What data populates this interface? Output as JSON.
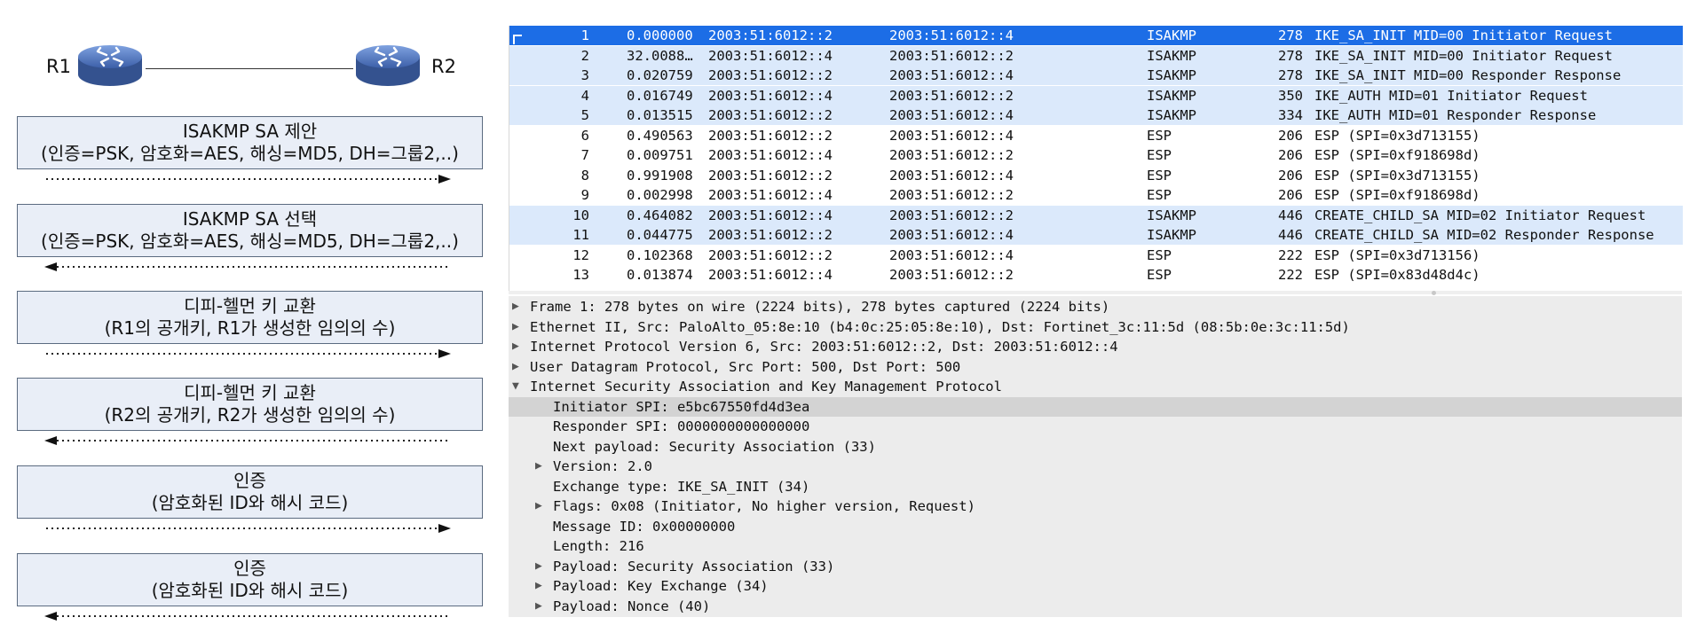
{
  "diagram": {
    "r1_label": "R1",
    "r2_label": "R2",
    "steps": [
      {
        "line1": "ISAKMP SA 제안",
        "line2": "(인증=PSK, 암호화=AES, 해싱=MD5, DH=그룹2,..)",
        "direction": "right"
      },
      {
        "line1": "ISAKMP SA 선택",
        "line2": "(인증=PSK, 암호화=AES, 해싱=MD5, DH=그룹2,..)",
        "direction": "left"
      },
      {
        "line1": "디피-헬먼 키 교환",
        "line2": "(R1의 공개키, R1가 생성한 임의의 수)",
        "direction": "right"
      },
      {
        "line1": "디피-헬먼 키 교환",
        "line2": "(R2의 공개키, R2가 생성한 임의의 수)",
        "direction": "left"
      },
      {
        "line1": "인증",
        "line2": "(암호화된 ID와 해시 코드)",
        "direction": "right"
      },
      {
        "line1": "인증",
        "line2": "(암호화된 ID와 해시 코드)",
        "direction": "left"
      }
    ]
  },
  "packets": [
    {
      "no": "1",
      "time": "0.000000",
      "src": "2003:51:6012::2",
      "dst": "2003:51:6012::4",
      "proto": "ISAKMP",
      "len": "278",
      "info": "IKE_SA_INIT MID=00 Initiator Request",
      "style": "selected"
    },
    {
      "no": "2",
      "time": "32.0088…",
      "src": "2003:51:6012::4",
      "dst": "2003:51:6012::2",
      "proto": "ISAKMP",
      "len": "278",
      "info": "IKE_SA_INIT MID=00 Initiator Request",
      "style": "isakmp"
    },
    {
      "no": "3",
      "time": "0.020759",
      "src": "2003:51:6012::2",
      "dst": "2003:51:6012::4",
      "proto": "ISAKMP",
      "len": "278",
      "info": "IKE_SA_INIT MID=00 Responder Response",
      "style": "isakmp"
    },
    {
      "no": "4",
      "time": "0.016749",
      "src": "2003:51:6012::4",
      "dst": "2003:51:6012::2",
      "proto": "ISAKMP",
      "len": "350",
      "info": "IKE_AUTH MID=01 Initiator Request",
      "style": "isakmp"
    },
    {
      "no": "5",
      "time": "0.013515",
      "src": "2003:51:6012::2",
      "dst": "2003:51:6012::4",
      "proto": "ISAKMP",
      "len": "334",
      "info": "IKE_AUTH MID=01 Responder Response",
      "style": "isakmp"
    },
    {
      "no": "6",
      "time": "0.490563",
      "src": "2003:51:6012::2",
      "dst": "2003:51:6012::4",
      "proto": "ESP",
      "len": "206",
      "info": "ESP (SPI=0x3d713155)",
      "style": "plain"
    },
    {
      "no": "7",
      "time": "0.009751",
      "src": "2003:51:6012::4",
      "dst": "2003:51:6012::2",
      "proto": "ESP",
      "len": "206",
      "info": "ESP (SPI=0xf918698d)",
      "style": "plain"
    },
    {
      "no": "8",
      "time": "0.991908",
      "src": "2003:51:6012::2",
      "dst": "2003:51:6012::4",
      "proto": "ESP",
      "len": "206",
      "info": "ESP (SPI=0x3d713155)",
      "style": "plain"
    },
    {
      "no": "9",
      "time": "0.002998",
      "src": "2003:51:6012::4",
      "dst": "2003:51:6012::2",
      "proto": "ESP",
      "len": "206",
      "info": "ESP (SPI=0xf918698d)",
      "style": "plain"
    },
    {
      "no": "10",
      "time": "0.464082",
      "src": "2003:51:6012::4",
      "dst": "2003:51:6012::2",
      "proto": "ISAKMP",
      "len": "446",
      "info": "CREATE_CHILD_SA MID=02 Initiator Request",
      "style": "isakmp"
    },
    {
      "no": "11",
      "time": "0.044775",
      "src": "2003:51:6012::2",
      "dst": "2003:51:6012::4",
      "proto": "ISAKMP",
      "len": "446",
      "info": "CREATE_CHILD_SA MID=02 Responder Response",
      "style": "isakmp"
    },
    {
      "no": "12",
      "time": "0.102368",
      "src": "2003:51:6012::2",
      "dst": "2003:51:6012::4",
      "proto": "ESP",
      "len": "222",
      "info": "ESP (SPI=0x3d713156)",
      "style": "plain"
    },
    {
      "no": "13",
      "time": "0.013874",
      "src": "2003:51:6012::4",
      "dst": "2003:51:6012::2",
      "proto": "ESP",
      "len": "222",
      "info": "ESP (SPI=0x83d48d4c)",
      "style": "plain"
    }
  ],
  "details": [
    {
      "text": "Frame 1: 278 bytes on wire (2224 bits), 278 bytes captured (2224 bits)",
      "level": 0,
      "toggle": "collapsed",
      "highlight": false
    },
    {
      "text": "Ethernet II, Src: PaloAlto_05:8e:10 (b4:0c:25:05:8e:10), Dst: Fortinet_3c:11:5d (08:5b:0e:3c:11:5d)",
      "level": 0,
      "toggle": "collapsed",
      "highlight": false
    },
    {
      "text": "Internet Protocol Version 6, Src: 2003:51:6012::2, Dst: 2003:51:6012::4",
      "level": 0,
      "toggle": "collapsed",
      "highlight": false
    },
    {
      "text": "User Datagram Protocol, Src Port: 500, Dst Port: 500",
      "level": 0,
      "toggle": "collapsed",
      "highlight": false
    },
    {
      "text": "Internet Security Association and Key Management Protocol",
      "level": 0,
      "toggle": "expanded",
      "highlight": false
    },
    {
      "text": "Initiator SPI: e5bc67550fd4d3ea",
      "level": 1,
      "toggle": "none",
      "highlight": true
    },
    {
      "text": "Responder SPI: 0000000000000000",
      "level": 1,
      "toggle": "none",
      "highlight": false
    },
    {
      "text": "Next payload: Security Association (33)",
      "level": 1,
      "toggle": "none",
      "highlight": false
    },
    {
      "text": "Version: 2.0",
      "level": 1,
      "toggle": "collapsed",
      "highlight": false
    },
    {
      "text": "Exchange type: IKE_SA_INIT (34)",
      "level": 1,
      "toggle": "none",
      "highlight": false
    },
    {
      "text": "Flags: 0x08 (Initiator, No higher version, Request)",
      "level": 1,
      "toggle": "collapsed",
      "highlight": false
    },
    {
      "text": "Message ID: 0x00000000",
      "level": 1,
      "toggle": "none",
      "highlight": false
    },
    {
      "text": "Length: 216",
      "level": 1,
      "toggle": "none",
      "highlight": false
    },
    {
      "text": "Payload: Security Association (33)",
      "level": 1,
      "toggle": "collapsed",
      "highlight": false
    },
    {
      "text": "Payload: Key Exchange (34)",
      "level": 1,
      "toggle": "collapsed",
      "highlight": false
    },
    {
      "text": "Payload: Nonce (40)",
      "level": 1,
      "toggle": "collapsed",
      "highlight": false
    }
  ],
  "colors": {
    "selected_row": "#1c6de6",
    "isakmp_row": "#dbe9fb",
    "detail_bg": "#ececec",
    "step_box_bg": "#e9eef7",
    "router_body": "#5b7ec2"
  },
  "icons": {
    "router": "router-icon",
    "expand": "triangle-right-icon",
    "collapse": "triangle-down-icon"
  }
}
